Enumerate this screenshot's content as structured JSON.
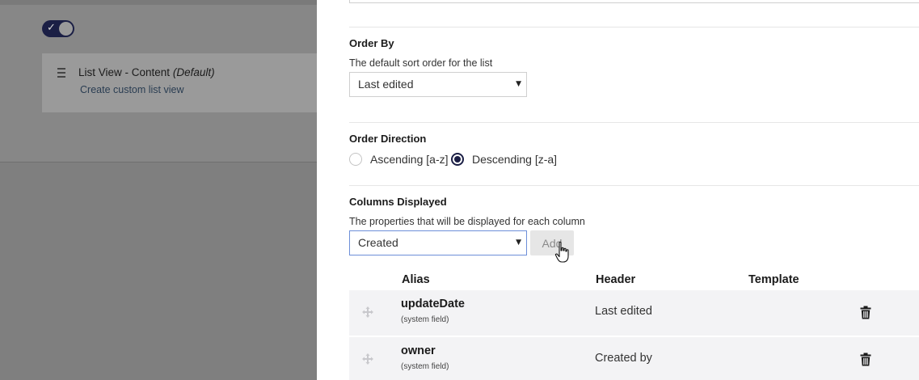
{
  "background": {
    "toggle_icon": "check-icon",
    "list_view": {
      "title": "List View - Content",
      "title_suffix": "(Default)",
      "link": "Create custom list view"
    }
  },
  "order_by": {
    "label": "Order By",
    "description": "The default sort order for the list",
    "selected": "Last edited"
  },
  "order_direction": {
    "label": "Order Direction",
    "options": [
      {
        "label": "Ascending [a-z]",
        "checked": false
      },
      {
        "label": "Descending [z-a]",
        "checked": true
      }
    ]
  },
  "columns": {
    "label": "Columns Displayed",
    "description": "The properties that will be displayed for each column",
    "selected": "Created",
    "add_label": "Add",
    "headers": {
      "alias": "Alias",
      "header": "Header",
      "template": "Template"
    },
    "rows": [
      {
        "alias": "updateDate",
        "note": "(system field)",
        "header": "Last edited"
      },
      {
        "alias": "owner",
        "note": "(system field)",
        "header": "Created by"
      }
    ]
  },
  "colors": {
    "accent": "#1b1f45",
    "focus_border": "#6d8fd9",
    "row_bg": "#f3f3f5",
    "overlay": "#7f7f7f"
  }
}
